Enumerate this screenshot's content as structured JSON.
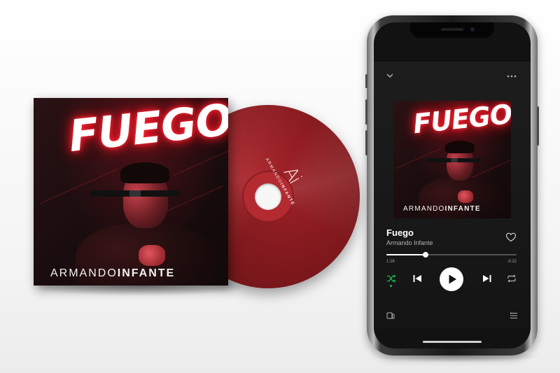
{
  "album": {
    "title": "FUEGO",
    "artist_first": "ARMANDO",
    "artist_last": "INFANTE"
  },
  "disc": {
    "monogram": "Ai",
    "label_first": "ARMANDO",
    "label_last": "INFANTE"
  },
  "player": {
    "collapse_icon": "chevron-down-icon",
    "more_icon": "more-icon",
    "track_title": "Fuego",
    "track_artist": "Armando Infante",
    "elapsed": "1:26",
    "remaining": "-3:22",
    "progress": 0.3,
    "accent": "#1db954",
    "icons": [
      "shuffle-icon",
      "previous-icon",
      "play-icon",
      "next-icon",
      "repeat-icon",
      "devices-icon",
      "queue-icon",
      "heart-icon"
    ]
  },
  "colors": {
    "background": "#ffffff",
    "disc": "#9b2226",
    "neon": "#ff2a3a",
    "screen": "#121212"
  }
}
